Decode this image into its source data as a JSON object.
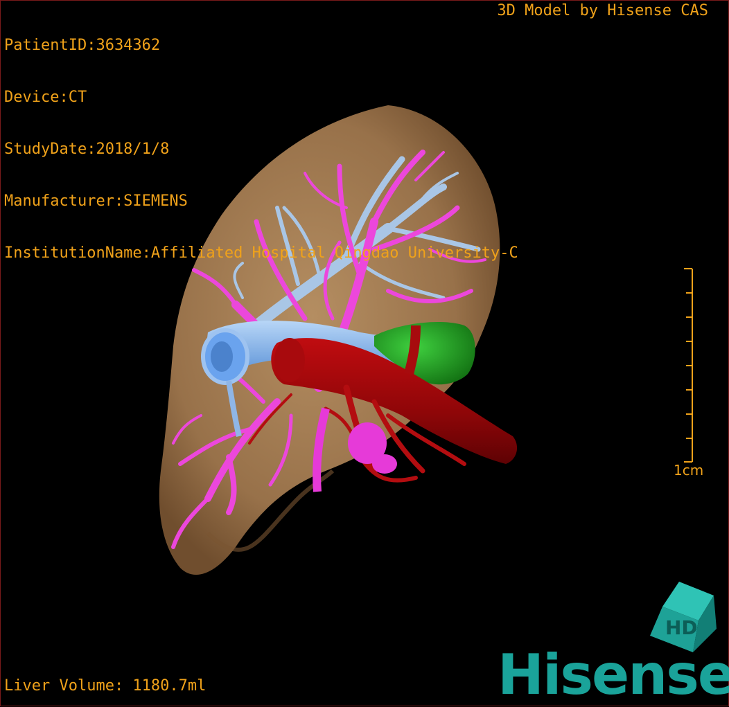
{
  "header": {
    "patient_id": "PatientID:3634362",
    "device": "Device:CT",
    "study_date": "StudyDate:2018/1/8",
    "manufacturer": "Manufacturer:SIEMENS",
    "institution": "InstitutionName:Affiliated Hospital Qingdao University-C",
    "model_credit": "3D Model by Hisense CAS"
  },
  "footer": {
    "liver_volume": "Liver Volume: 1180.7ml"
  },
  "scale_bar": {
    "label": "1cm"
  },
  "logo": {
    "brand": "Hisense",
    "cube_letters": "HD"
  },
  "colors": {
    "liver": "#b4895c",
    "portal_vein": "#ee44dd",
    "hepatic_vein": "#8fb6e6",
    "ivc": "#6aa3ee",
    "artery": "#b30d10",
    "gallbladder": "#1fa01f",
    "hud_text": "#f0a21a",
    "brand": "#1aa39a"
  }
}
